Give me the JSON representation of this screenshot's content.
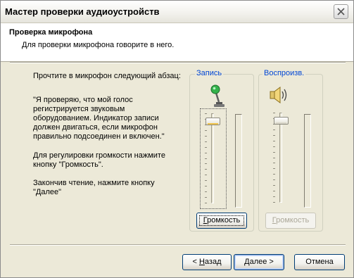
{
  "window": {
    "title": "Мастер проверки аудиоустройств"
  },
  "header": {
    "title": "Проверка микрофона",
    "subtitle": "Для проверки микрофона говорите в него."
  },
  "instructions": {
    "intro": "Прочтите в микрофон следующий абзац:",
    "quote_lines": [
      "\"Я проверяю, что мой голос",
      "регистрируется звуковым",
      "оборудованием. Индикатор записи",
      "должен двигаться, если микрофон",
      "правильно подсоединен и включен.\""
    ],
    "volume_lines": [
      "Для регулировки громкости нажмите",
      "кнопку \"Громкость\"."
    ],
    "finish_lines": [
      "Закончив чтение, нажмите кнопку",
      "\"Далее\""
    ]
  },
  "recording": {
    "label": "Запись",
    "volume_button": {
      "mnemonic": "Г",
      "rest": "ромкость"
    },
    "slider_level": 0.95,
    "icon": "microphone-icon"
  },
  "playback": {
    "label": "Воспроизв.",
    "volume_button": {
      "mnemonic": "Г",
      "rest": "ромкость"
    },
    "slider_level": 0.95,
    "enabled": false,
    "icon": "speaker-icon"
  },
  "footer": {
    "back": {
      "prefix": "< ",
      "mnemonic": "Н",
      "rest": "азад"
    },
    "next": {
      "prefix": "",
      "mnemonic": "Д",
      "rest": "алее >"
    },
    "cancel": "Отмена"
  },
  "colors": {
    "group_label": "#0046D5",
    "dialog_bg": "#ECE9D8",
    "button_border": "#003C74",
    "slider_accent": "#F0C348"
  }
}
